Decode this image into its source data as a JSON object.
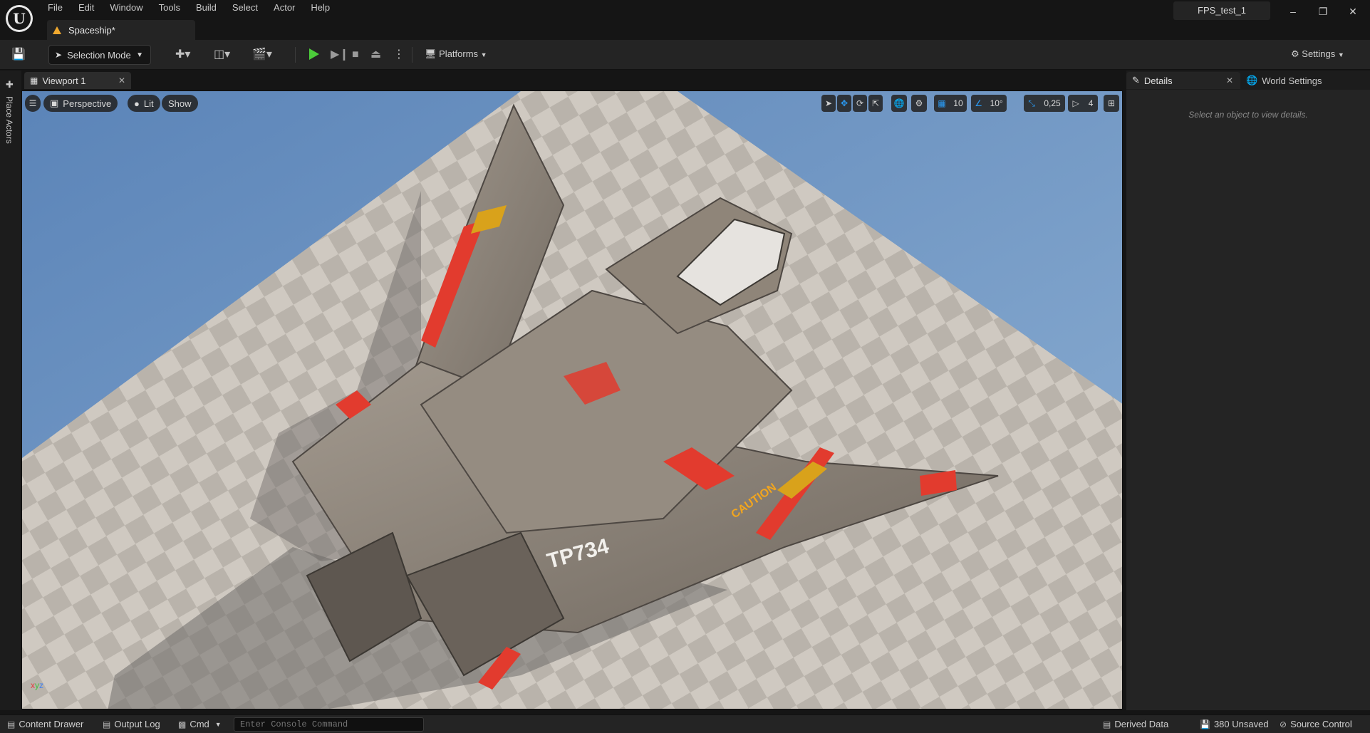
{
  "menu": [
    "File",
    "Edit",
    "Window",
    "Tools",
    "Build",
    "Select",
    "Actor",
    "Help"
  ],
  "document_tab": "Spaceship*",
  "project_name": "FPS_test_1",
  "toolbar": {
    "selection_mode": "Selection Mode",
    "platforms": "Platforms",
    "settings": "Settings"
  },
  "left_strip": {
    "place_actors": "Place Actors"
  },
  "viewport_tab": {
    "label": "Viewport 1"
  },
  "viewport": {
    "perspective": "Perspective",
    "lit": "Lit",
    "show": "Show",
    "grid_snap": "10",
    "rotation_snap": "10°",
    "scale_snap": "0,25",
    "camera_speed": "4",
    "ground_colors": [
      "#cfc9c1",
      "#b9b3ab"
    ],
    "sky_colors": [
      "#5b84b8",
      "#8eb0d3"
    ],
    "ship_decals": [
      "TP734",
      "CAUTION"
    ]
  },
  "details": {
    "tab_label": "Details",
    "world_settings_label": "World Settings",
    "empty_message": "Select an object to view details."
  },
  "statusbar": {
    "content_drawer": "Content Drawer",
    "output_log": "Output Log",
    "cmd": "Cmd",
    "console_placeholder": "Enter Console Command",
    "derived_data": "Derived Data",
    "unsaved": "380 Unsaved",
    "source_control": "Source Control"
  },
  "colors": {
    "accent_blue": "#2a9bf5",
    "play_green": "#4ccc3a",
    "warning_orange": "#f0a92f",
    "ship_red": "#e23b2e"
  }
}
